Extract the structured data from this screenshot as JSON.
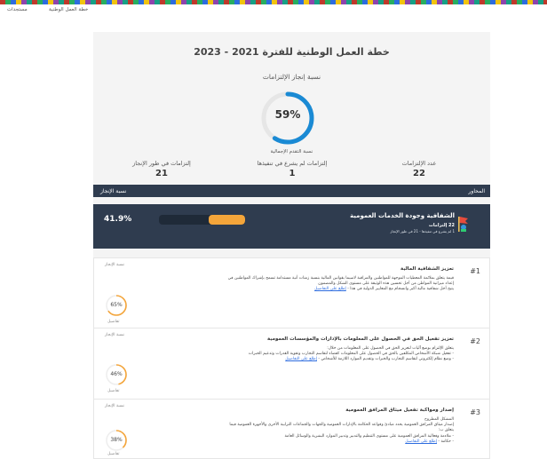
{
  "nav": {
    "national_plan": "خطة العمل الوطنية",
    "updates": "مستجدات"
  },
  "colors": {
    "header_bg": "#2f3c4f",
    "progress": "#f4a53a",
    "ring_main": "#1a8ad4",
    "ring_item": "#f4a53a"
  },
  "page": {
    "title": "خطة العمل الوطنية للفترة 2021 - 2023",
    "subtitle": "نسبة إنجاز الإلتزامات",
    "overall_progress": 59,
    "overall_progress_text": "59%",
    "overall_label": "نسبة التقدم الإجمالية"
  },
  "stats": {
    "total": {
      "label": "عدد الإلتزامات",
      "value": "22"
    },
    "not_started": {
      "label": "إلتزامات لم يشرع في تنفيذها",
      "value": "1"
    },
    "in_progress": {
      "label": "إلتزامات في طور الإنجاز",
      "value": "21"
    }
  },
  "axes_header": {
    "axes": "المحاور",
    "completion": "نسبة الإنجاز"
  },
  "axis": {
    "icon": "flag-icon",
    "name": "الشفافية وجودة الخدمات العمومية",
    "count": "22 إلتزامات",
    "detail": "1 لم يشرع في تنفيذها - 21 في طور الإنجاز",
    "progress": 41.9,
    "progress_text": "41.9%"
  },
  "commitments": [
    {
      "number": "#1",
      "title": "تعزيز الشفافية المالية",
      "body": "قيمة يتعلق بملائمة المعطيات الموجهة للمواطنين والمراقبة لاسيما بقوانين المالية بنسبة زمنات أنية مستدامة تسمح بإشراك المواطنين في\nإعداد ميزانية المواطن من أجل تحسين هذه الوثيقة على مستوى الشكل والمضمون\nيتيح أجل شفافية مالية أكبر وانسجام مع المعايير الدولية في هذا",
      "more": "إطلع على التفاصيل",
      "progress_label": "نسبة الإنجاز",
      "progress": 65,
      "progress_text": "65%",
      "details": "تفاصيل"
    },
    {
      "number": "#2",
      "title": "تعزيز تفعيل الحق في الحصول على المعلومات بالإدارات والمؤسسات العمومية",
      "body": "يتعلق الإلتزام بوضع آليات لتعزيز الحق في الحصول على المعلومات من خلال:\n- تفعيل شبكة الأشخاص المكلفين بالحق في الحصول على المعلومات كفضاء لتقاسم التجارب وتقوية القدرات وتدعيم الخبرات\n- وضع نظام إلكتروني لتقاسم التجارب والخبرات وتقديم الموارد اللازمة للأشخاص",
      "more": "إطلع على التفاصيل",
      "progress_label": "نسبة الإنجاز",
      "progress": 46,
      "progress_text": "46%",
      "details": "تفاصيل"
    },
    {
      "number": "#3",
      "title": "إصدار ومواكبة تفعيل ميثاق المرافق العمومية",
      "body": "المشكل المطروح\nإصدار ميثاق المرافق العمومية يحدد مبادئ وقواعد الحكامة بالإدارات العمومية والجهات والجماعات الترابية الأخرى والأجهزة العمومية فيما\nيتعلق ب:\n- ملاءمة وفعالية المرافق العمومية على مستوى التنظيم والتدبير وتدبير الموارد البشرية والوسائل العامة\n- حكامة",
      "more": "إطلع على التفاصيل",
      "progress_label": "نسبة الإنجاز",
      "progress": 38,
      "progress_text": "38%",
      "details": "تفاصيل"
    }
  ]
}
